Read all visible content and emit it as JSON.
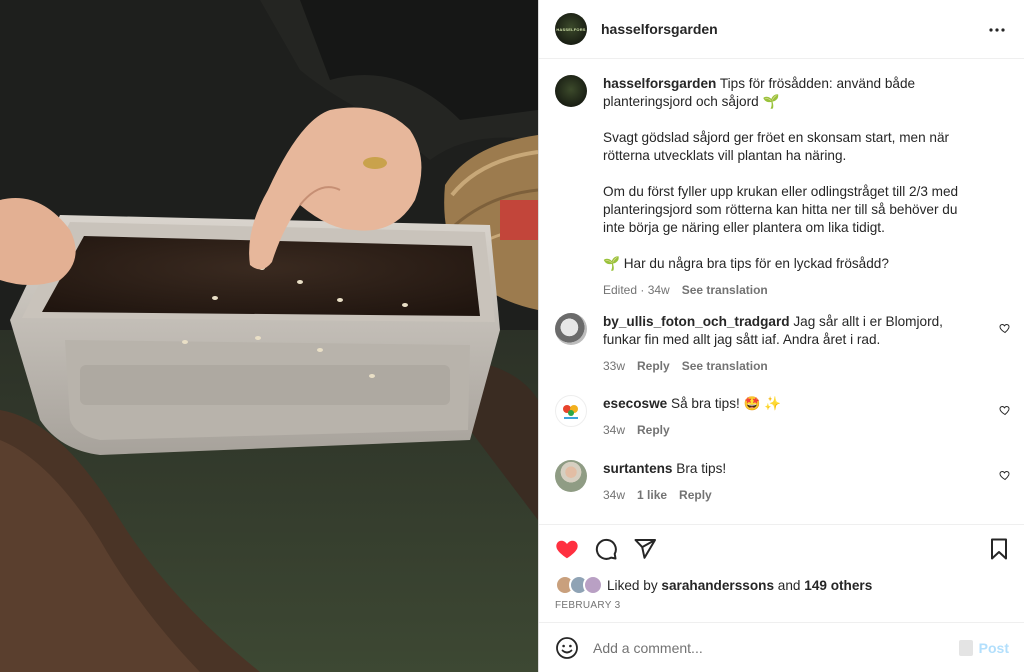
{
  "header": {
    "username": "hasselforsgarden",
    "logo_text": "HASSELFORS",
    "more_label": "•••"
  },
  "caption": {
    "username": "hasselforsgarden",
    "line1": "Tips för frösådden: använd både planteringsjord och såjord 🌱",
    "para2": "Svagt gödslad såjord ger fröet en skonsam start, men när rötterna utvecklats vill plantan ha näring.",
    "para3": "Om du först fyller upp krukan eller odlingstråget till 2/3 med planteringsjord som rötterna kan hitta ner till så behöver du inte börja ge näring eller plantera om lika tidigt.",
    "para4": "🌱 Har du några bra tips för en lyckad frösådd?",
    "edited": "Edited · 34w",
    "translate": "See translation"
  },
  "comments": [
    {
      "username": "by_ullis_foton_och_tradgard",
      "text": "Jag sår allt i er Blomjord, funkar fin med allt jag sått iaf. Andra året i rad.",
      "time": "33w",
      "reply": "Reply",
      "translate": "See translation"
    },
    {
      "username": "esecoswe",
      "text": "Så bra tips! 🤩 ✨",
      "time": "34w",
      "reply": "Reply"
    },
    {
      "username": "surtantens",
      "text": "Bra tips!",
      "time": "34w",
      "likes": "1 like",
      "reply": "Reply"
    }
  ],
  "actions": {
    "liked_by_prefix": "Liked by",
    "liked_by_user": "sarahanderssons",
    "and": "and",
    "others": "149 others",
    "date": "FEBRUARY 3"
  },
  "add_comment": {
    "placeholder": "Add a comment...",
    "post_label": "Post"
  },
  "colors": {
    "like_red": "#ff3040",
    "post_blue": "#b2dffc",
    "muted": "#737373"
  }
}
